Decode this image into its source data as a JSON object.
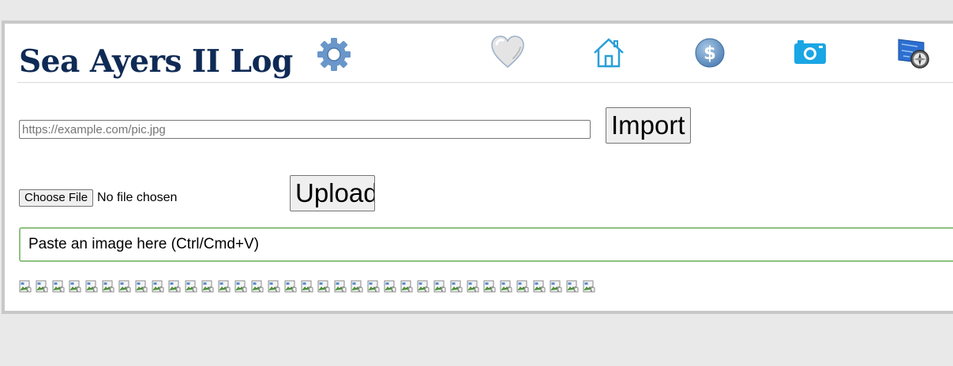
{
  "header": {
    "title": "Sea Ayers II Log",
    "settings_icon": "gear-icon",
    "nav_icons": [
      "heart-icon",
      "home-icon",
      "dollar-icon",
      "camera-icon",
      "map-compass-icon"
    ]
  },
  "import_form": {
    "url_placeholder": "https://example.com/pic.jpg",
    "url_value": "",
    "import_label": "Import"
  },
  "upload_form": {
    "choose_file_label": "Choose File",
    "file_status": "No file chosen",
    "upload_label": "Upload"
  },
  "paste_area": {
    "prompt": "Paste an image here (Ctrl/Cmd+V)"
  },
  "gallery": {
    "broken_image_count": 35
  },
  "colors": {
    "title": "#0f2a55",
    "paste_border": "#8fc181",
    "frame_border": "#c8c8c8",
    "page_background": "#e9e9e9"
  }
}
